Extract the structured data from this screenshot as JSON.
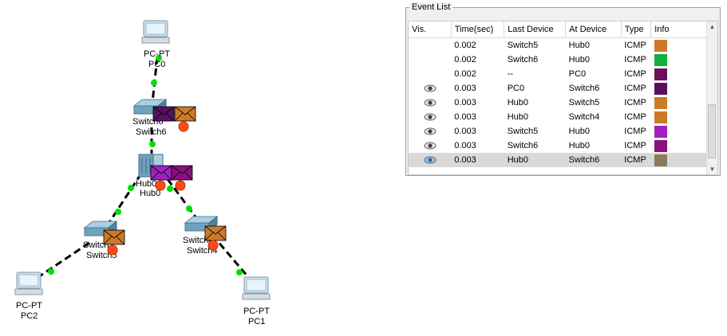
{
  "topology": {
    "devices": [
      {
        "id": "pc0",
        "type": "PC-PT",
        "name": "PC0"
      },
      {
        "id": "switch6",
        "type": "Switch",
        "name": "Switch6",
        "overlay_name": "Switch6"
      },
      {
        "id": "hub0",
        "type": "Hub",
        "name": "Hub0",
        "overlay_name": "Hub0"
      },
      {
        "id": "switch5",
        "type": "Switch",
        "name": "Switch5",
        "overlay_name": "Switch5"
      },
      {
        "id": "switch4",
        "type": "Switch",
        "name": "Switch4",
        "overlay_name": "Switch4"
      },
      {
        "id": "pc2",
        "type": "PC-PT",
        "name": "PC2"
      },
      {
        "id": "pc1",
        "type": "PC-PT",
        "name": "PC1"
      }
    ],
    "link_colors": {
      "cable": "#000000",
      "port_up": "#00e000"
    },
    "pdu_colors": {
      "orange": "#cc7a2a",
      "purple": "#7a1a7a",
      "violet": "#a020c0"
    }
  },
  "event_list": {
    "title": "Event List",
    "columns": [
      "Vis.",
      "Time(sec)",
      "Last Device",
      "At Device",
      "Type",
      "Info"
    ],
    "rows": [
      {
        "visible": false,
        "time": "0.002",
        "last": "Switch5",
        "at": "Hub0",
        "type": "ICMP",
        "color": "#cc7a2a",
        "selected": false
      },
      {
        "visible": false,
        "time": "0.002",
        "last": "Switch6",
        "at": "Hub0",
        "type": "ICMP",
        "color": "#10b040",
        "selected": false
      },
      {
        "visible": false,
        "time": "0.002",
        "last": "--",
        "at": "PC0",
        "type": "ICMP",
        "color": "#6a0f5a",
        "selected": false
      },
      {
        "visible": true,
        "time": "0.003",
        "last": "PC0",
        "at": "Switch6",
        "type": "ICMP",
        "color": "#5a1060",
        "selected": false
      },
      {
        "visible": true,
        "time": "0.003",
        "last": "Hub0",
        "at": "Switch5",
        "type": "ICMP",
        "color": "#cc7a2a",
        "selected": false
      },
      {
        "visible": true,
        "time": "0.003",
        "last": "Hub0",
        "at": "Switch4",
        "type": "ICMP",
        "color": "#cc7a2a",
        "selected": false
      },
      {
        "visible": true,
        "time": "0.003",
        "last": "Switch5",
        "at": "Hub0",
        "type": "ICMP",
        "color": "#a020c0",
        "selected": false
      },
      {
        "visible": true,
        "time": "0.003",
        "last": "Switch6",
        "at": "Hub0",
        "type": "ICMP",
        "color": "#8a1080",
        "selected": false
      },
      {
        "visible": true,
        "time": "0.003",
        "last": "Hub0",
        "at": "Switch6",
        "type": "ICMP",
        "color": "#8c7a5a",
        "selected": true
      }
    ]
  }
}
